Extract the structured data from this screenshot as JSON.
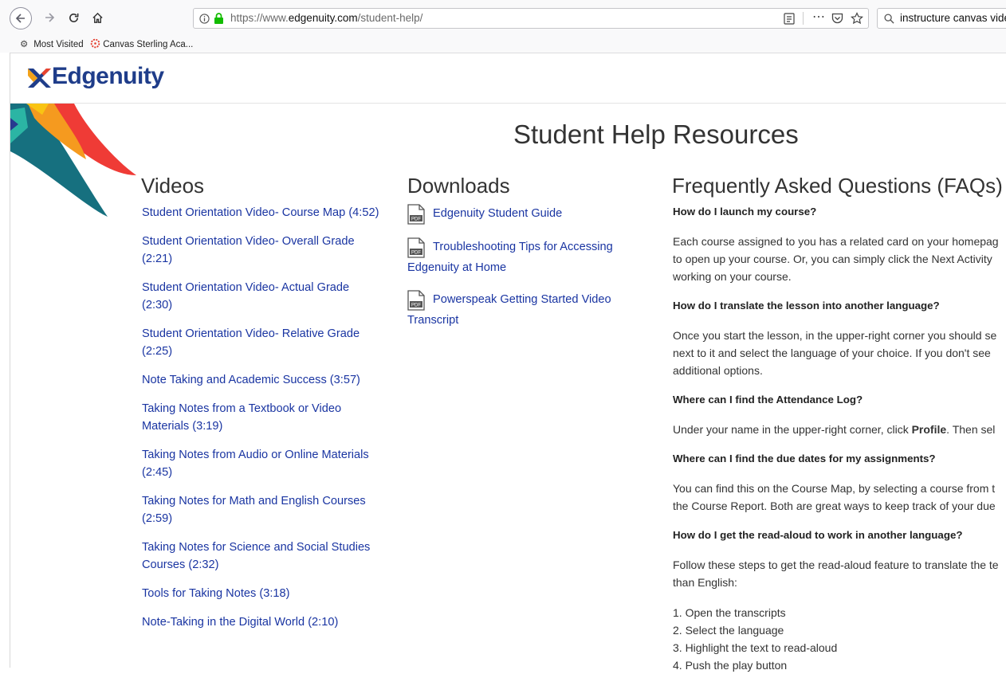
{
  "browser": {
    "url_prefix": "https://www.",
    "url_domain": "edgenuity.com",
    "url_path": "/student-help/",
    "search_value": "instructure canvas vide",
    "bookmarks": [
      {
        "label": "Most Visited"
      },
      {
        "label": "Canvas Sterling Aca..."
      }
    ]
  },
  "header": {
    "logo_text": "Edgenuity"
  },
  "page": {
    "title": "Student Help Resources",
    "videos": {
      "title": "Videos",
      "items": [
        {
          "label": "Student Orientation Video- Course Map (4:52)"
        },
        {
          "label": "Student Orientation Video- Overall Grade (2:21)"
        },
        {
          "label": "Student Orientation Video- Actual Grade (2:30)"
        },
        {
          "label": "Student Orientation Video- Relative Grade (2:25)"
        },
        {
          "label": "Note Taking and Academic Success (3:57)"
        },
        {
          "label": "Taking Notes from a Textbook or Video Materials (3:19)"
        },
        {
          "label": "Taking Notes from Audio or Online Materials (2:45)"
        },
        {
          "label": "Taking Notes for Math and English Courses (2:59)"
        },
        {
          "label": "Taking Notes for Science and Social Studies Courses (2:32)"
        },
        {
          "label": "Tools for Taking Notes (3:18)"
        },
        {
          "label": "Note-Taking in the Digital World (2:10)"
        }
      ]
    },
    "downloads": {
      "title": "Downloads",
      "pdf_label": "PDF",
      "items": [
        {
          "label": "Edgenuity Student Guide"
        },
        {
          "label": "Troubleshooting Tips for Accessing Edgenuity at Home"
        },
        {
          "label": "Powerspeak Getting Started Video Transcript"
        }
      ]
    },
    "faq": {
      "title": "Frequently Asked Questions (FAQs)",
      "q1": "How do I launch my course?",
      "a1": [
        "Each course assigned to you has a related card on your homepag",
        "to open up your course. Or, you can simply click the Next Activity",
        "working on your course."
      ],
      "q2": "How do I translate the lesson into another language?",
      "a2": [
        "Once you start the lesson, in the upper-right corner you should se",
        "next to it and select the language of your choice. If you don't see",
        "additional options."
      ],
      "q3": "Where can I find the Attendance Log?",
      "a3_pre": "Under your name in the upper-right corner, click ",
      "a3_bold": "Profile",
      "a3_post": ". Then sel",
      "q4": "Where can I find the due dates for my assignments?",
      "a4": [
        "You can find this on the Course Map, by selecting a course from t",
        "the Course Report. Both are great ways to keep track of your due"
      ],
      "q5": "How do I get the read-aloud to work in another language?",
      "a5": [
        "Follow these steps to get the read-aloud feature to translate the te",
        "than English:"
      ],
      "steps": [
        "1. Open the transcripts",
        "2. Select the language",
        "3. Highlight the text to read-aloud",
        "4. Push the play button"
      ]
    }
  }
}
